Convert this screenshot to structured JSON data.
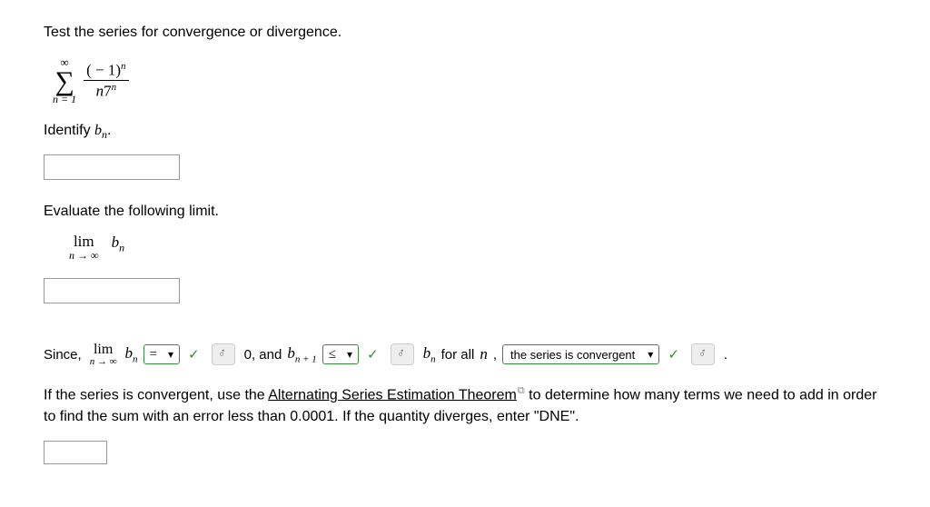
{
  "question": {
    "prompt": "Test the series for convergence or divergence.",
    "series_upper": "∞",
    "series_lower_lhs": "n",
    "series_lower_rhs": "1",
    "frac_num_open": "( − 1)",
    "frac_num_exp": "n",
    "frac_den_coef": "n",
    "frac_den_base": "7",
    "frac_den_exp": "n"
  },
  "identify": {
    "label_pre": "Identify ",
    "var_letter": "b",
    "var_sub": "n",
    "label_post": "."
  },
  "eval": {
    "heading": "Evaluate the following limit.",
    "lim_word": "lim",
    "lim_sub": "n → ∞",
    "lim_var_letter": "b",
    "lim_var_sub": "n"
  },
  "flow": {
    "since": "Since, ",
    "lim_word": "lim",
    "lim_sub": "n → ∞",
    "bn_letter": "b",
    "bn_sub": "n",
    "sel1_value": "=",
    "zero_and": " 0, and ",
    "bnp1_letter": "b",
    "bnp1_sub": "n + 1",
    "sel2_value": "≤",
    "forall_pre": " ",
    "bn2_letter": "b",
    "bn2_sub": "n",
    "forall": " for all ",
    "n_text": "n",
    "comma": ", ",
    "sel3_value": "the series is convergent",
    "period": " ."
  },
  "closing": {
    "text_pre": "If the series is convergent, use the ",
    "link_text": "Alternating Series Estimation Theorem",
    "text_post": " to determine how many terms we need to add in order to find the sum with an error less than 0.0001. If the quantity diverges, enter \"DNE\"."
  }
}
